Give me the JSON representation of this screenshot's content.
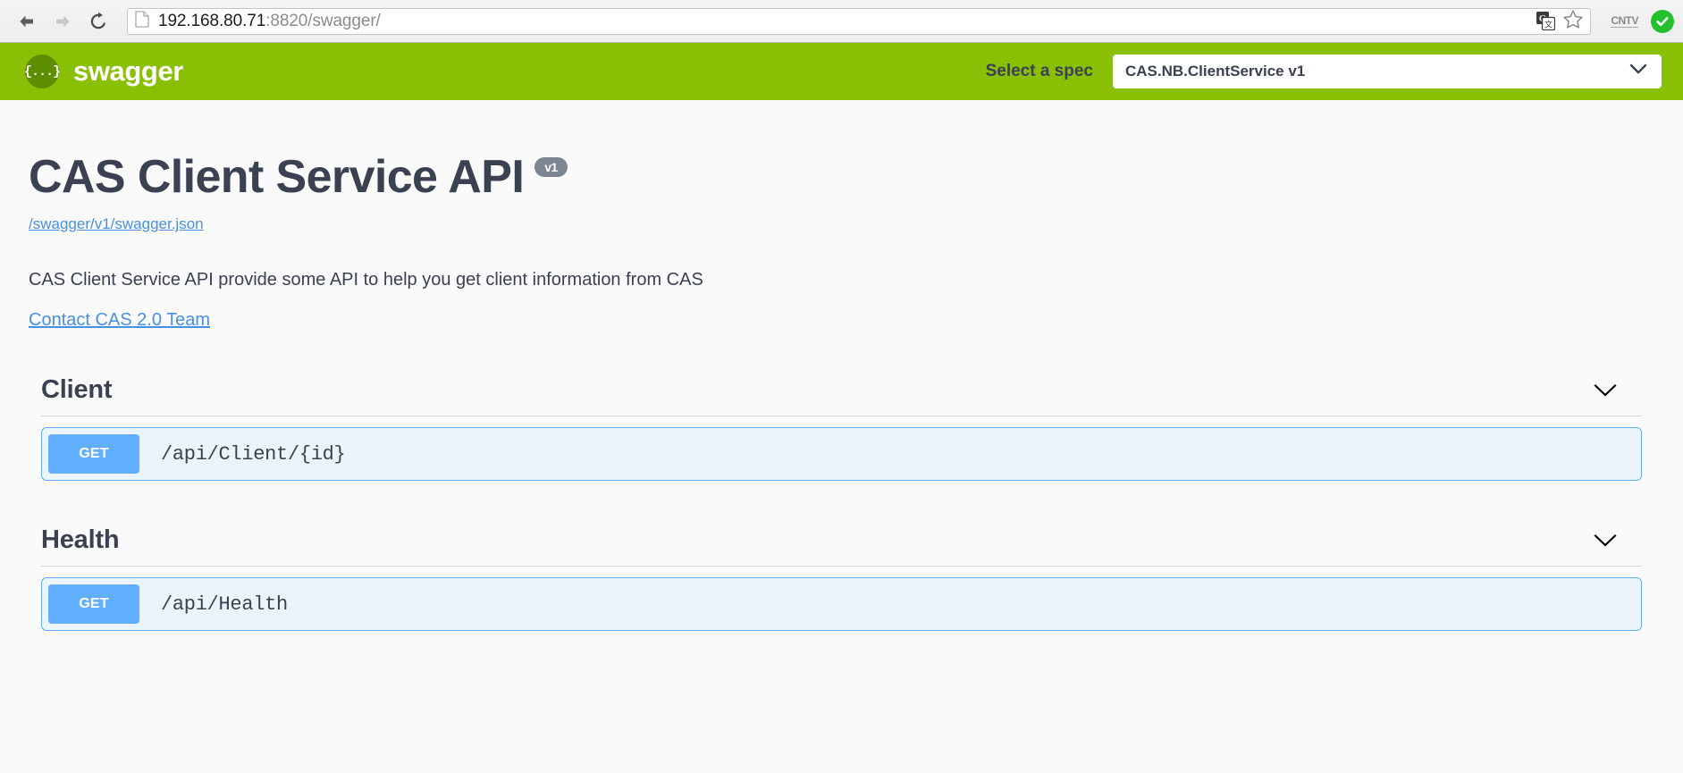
{
  "browser": {
    "back_icon": "back-arrow-icon",
    "forward_icon": "forward-arrow-icon",
    "reload_icon": "reload-icon",
    "page_icon": "page-document-icon",
    "url_host": "192.168.80.71",
    "url_rest": ":8820/swagger/",
    "translate_icon": "google-translate-icon",
    "bookmark_icon": "star-bookmark-icon",
    "extension_label": "CNTV",
    "status_icon": "green-check-icon"
  },
  "topbar": {
    "logo_glyph": "{...}",
    "logo_text": "swagger",
    "select_spec_label": "Select a spec",
    "selected_spec": "CAS.NB.ClientService v1",
    "chevron_icon": "chevron-down-icon",
    "background_color": "#89bf04"
  },
  "info": {
    "title": "CAS Client Service API",
    "version_badge": "v1",
    "spec_url": "/swagger/v1/swagger.json",
    "description": "CAS Client Service API provide some API to help you get client information from CAS",
    "contact_text": "Contact CAS 2.0 Team"
  },
  "tags": [
    {
      "name": "Client",
      "chevron_icon": "chevron-down-icon",
      "operations": [
        {
          "method": "GET",
          "path": "/api/Client/{id}",
          "method_color": "#61affe"
        }
      ]
    },
    {
      "name": "Health",
      "chevron_icon": "chevron-down-icon",
      "operations": [
        {
          "method": "GET",
          "path": "/api/Health",
          "method_color": "#61affe"
        }
      ]
    }
  ]
}
